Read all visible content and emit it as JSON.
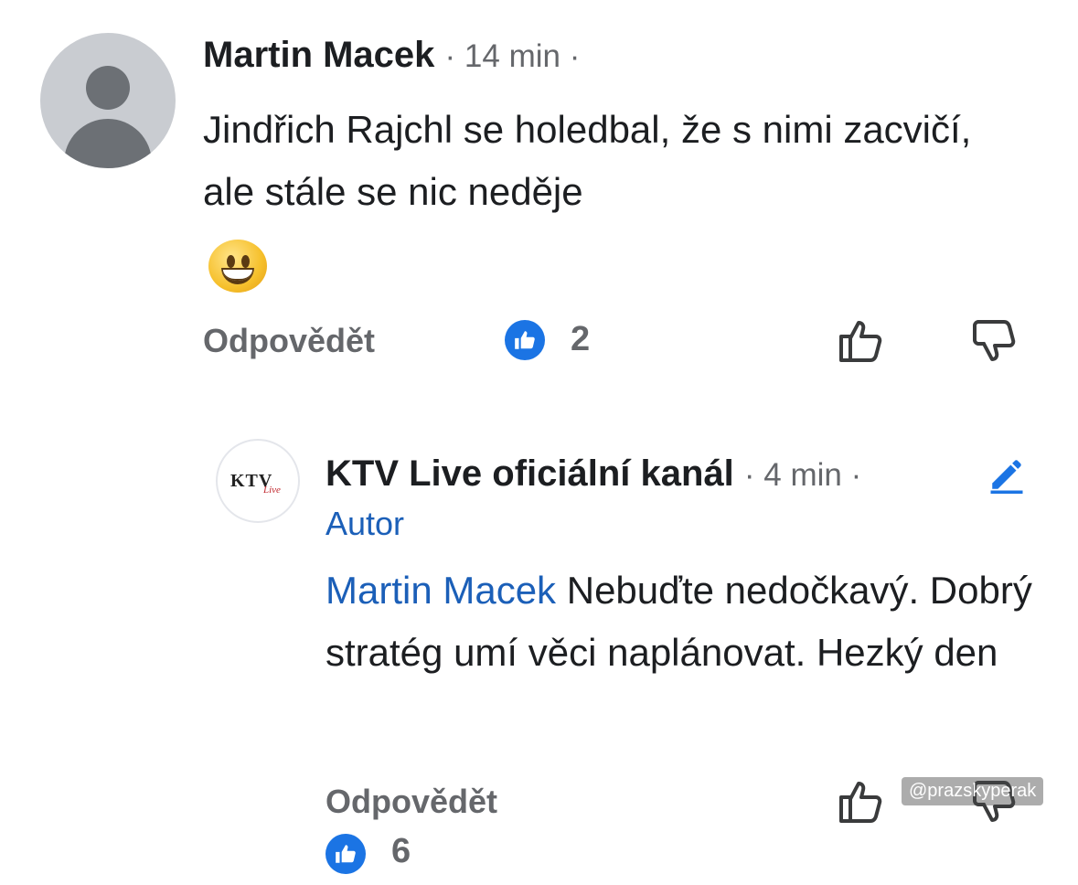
{
  "comment": {
    "author": "Martin Macek",
    "time": "· 14 min ·",
    "text": "Jindřich Rajchl se holedbal, že s nimi zacvičí, ale stále se nic neděje",
    "emoji": "grinning-face-icon",
    "reply_label": "Odpovědět",
    "like_count": "2"
  },
  "reply": {
    "author": "KTV Live oficiální kanál",
    "time": "· 4 min ·",
    "badge": "Autor",
    "mention": "Martin Macek",
    "text": "Nebuďte nedočkavý. Dobrý stratég umí věci naplánovat. Hezký den",
    "reply_label": "Odpovědět",
    "like_count": "6",
    "avatar_logo": "KTV",
    "avatar_logo_sub": "Live"
  },
  "watermark": "@prazskyperak",
  "colors": {
    "accent_blue": "#1b74e4",
    "mention_blue": "#1b5fb8",
    "meta_gray": "#65676b",
    "icon_gray": "#3a3b3c"
  }
}
